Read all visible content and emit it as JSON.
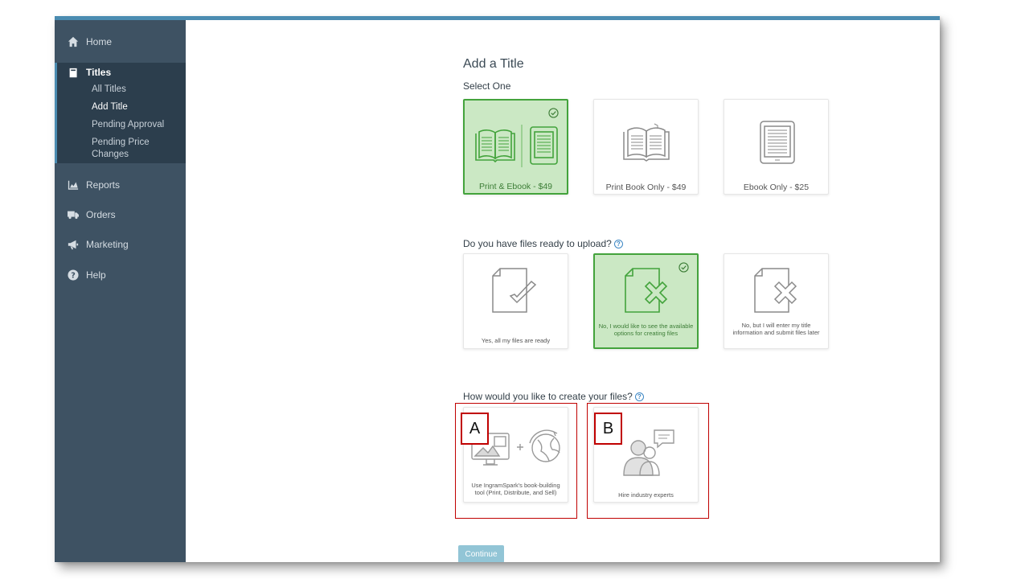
{
  "sidebar": {
    "home": "Home",
    "titles": "Titles",
    "titles_sub": [
      "All Titles",
      "Add Title",
      "Pending Approval",
      "Pending Price Changes"
    ],
    "reports": "Reports",
    "orders": "Orders",
    "marketing": "Marketing",
    "help": "Help"
  },
  "main": {
    "page_title": "Add a Title",
    "select_one": "Select One",
    "format_options": [
      {
        "label": "Print & Ebook - $49",
        "selected": true
      },
      {
        "label": "Print Book Only - $49",
        "selected": false
      },
      {
        "label": "Ebook Only - $25",
        "selected": false
      }
    ],
    "files_question": "Do you have files ready to upload?",
    "files_options": [
      {
        "label": "Yes, all my files are ready",
        "selected": false
      },
      {
        "label": "No, I would like to see the available options for creating files",
        "selected": true
      },
      {
        "label": "No, but I will enter my title information and submit files later",
        "selected": false
      }
    ],
    "create_question": "How would you like to create your files?",
    "create_options": [
      {
        "label": "Use IngramSpark's book-building tool (Print, Distribute, and Sell)",
        "marker": "A"
      },
      {
        "label": "Hire industry experts",
        "marker": "B"
      }
    ],
    "continue_label": "Continue"
  },
  "colors": {
    "sidebar_bg": "#3e5263",
    "sidebar_active_bg": "#2c3e4d",
    "selected_fill": "#cbe8c4",
    "selected_border": "#43a33c",
    "annotation_red": "#c00000",
    "continue_bg": "#92c5d6"
  }
}
